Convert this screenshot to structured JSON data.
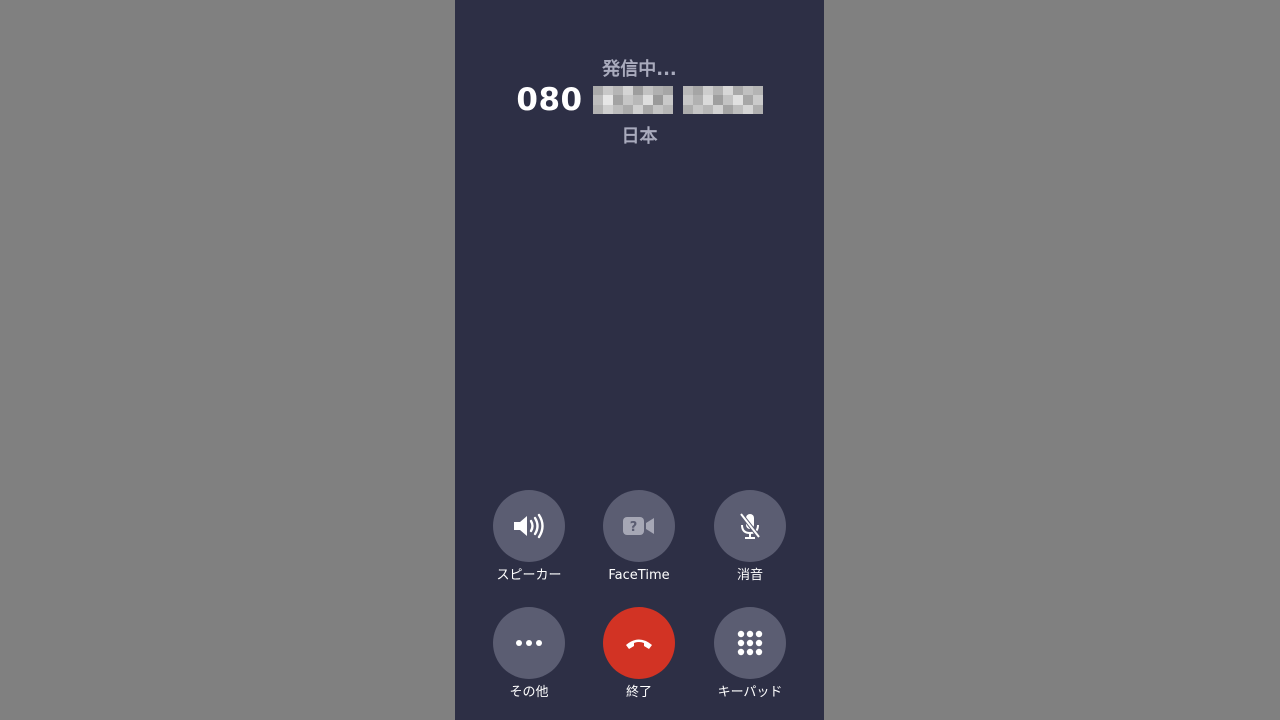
{
  "call": {
    "status": "発信中...",
    "number_prefix": "080",
    "country": "日本"
  },
  "controls": {
    "speaker": {
      "label": "スピーカー",
      "icon": "speaker-icon"
    },
    "facetime": {
      "label": "FaceTime",
      "icon": "facetime-icon"
    },
    "mute": {
      "label": "消音",
      "icon": "mic-off-icon"
    },
    "more": {
      "label": "その他",
      "icon": "more-icon"
    },
    "end": {
      "label": "終了",
      "icon": "hang-up-icon"
    },
    "keypad": {
      "label": "キーパッド",
      "icon": "keypad-icon"
    }
  },
  "colors": {
    "background": "#2d2f45",
    "button": "#5b5d72",
    "end_button": "#d23324"
  }
}
